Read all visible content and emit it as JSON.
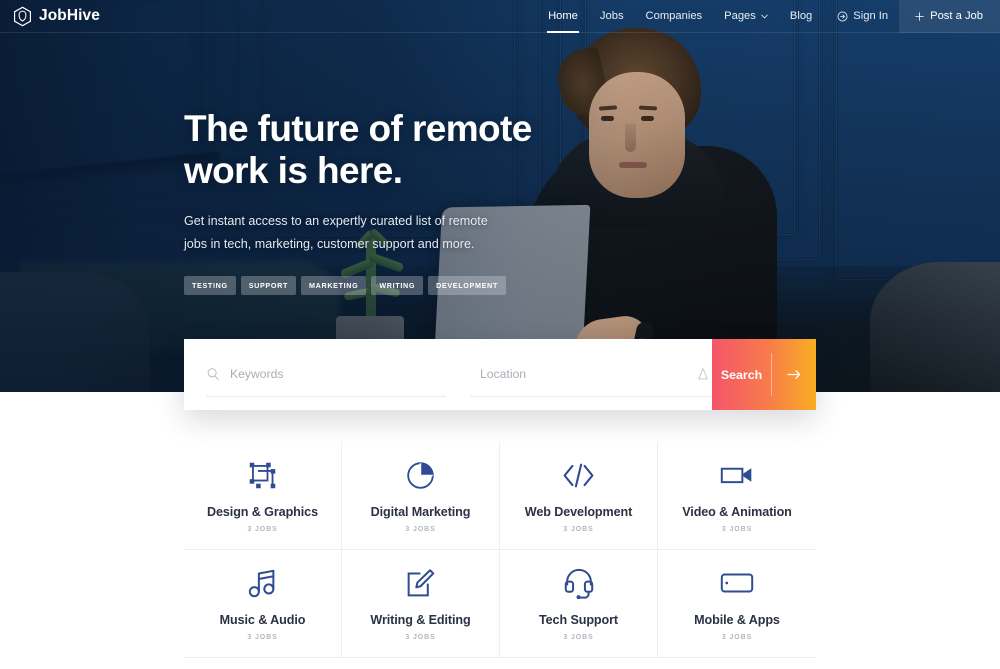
{
  "brand": {
    "name": "JobHive",
    "logo_icon": "hexagon-hive-logo"
  },
  "nav": {
    "items": [
      {
        "label": "Home",
        "active": true
      },
      {
        "label": "Jobs",
        "active": false
      },
      {
        "label": "Companies",
        "active": false
      },
      {
        "label": "Pages",
        "active": false,
        "icon": "chevron-down-icon"
      },
      {
        "label": "Blog",
        "active": false
      }
    ],
    "sign_in": {
      "label": "Sign In",
      "icon": "sign-in-arrow-circle-icon"
    },
    "post_a_job": {
      "label": "Post a Job",
      "icon": "plus-icon"
    }
  },
  "hero": {
    "title_line1": "The future of remote",
    "title_line2": "work is here.",
    "subtitle_line1": "Get instant access to an expertly curated list of remote jobs in",
    "subtitle_line2": "tech, marketing, customer support and more.",
    "tags": [
      "Testing",
      "Support",
      "Marketing",
      "Writing",
      "Development"
    ]
  },
  "search": {
    "keywords": {
      "placeholder": "Keywords",
      "value": "",
      "icon": "search-icon"
    },
    "location": {
      "placeholder": "Location",
      "value": "",
      "icon": "location-pin-icon"
    },
    "button": {
      "label": "Search",
      "arrow_icon": "arrow-right-icon"
    }
  },
  "categories": {
    "items": [
      {
        "name": "Design & Graphics",
        "jobs": "3 Jobs",
        "icon": "crop-frame-icon"
      },
      {
        "name": "Digital Marketing",
        "jobs": "3 Jobs",
        "icon": "pie-chart-icon"
      },
      {
        "name": "Web Development",
        "jobs": "3 Jobs",
        "icon": "code-brackets-icon"
      },
      {
        "name": "Video & Animation",
        "jobs": "3 Jobs",
        "icon": "video-camera-icon"
      },
      {
        "name": "Music & Audio",
        "jobs": "3 Jobs",
        "icon": "music-note-icon"
      },
      {
        "name": "Writing & Editing",
        "jobs": "3 Jobs",
        "icon": "edit-pencil-square-icon"
      },
      {
        "name": "Tech Support",
        "jobs": "3 Jobs",
        "icon": "headset-icon"
      },
      {
        "name": "Mobile & Apps",
        "jobs": "3 Jobs",
        "icon": "tablet-device-icon"
      }
    ]
  },
  "colors": {
    "hero_navy": "#12355e",
    "accent_start": "#f4556a",
    "accent_end": "#f9ae22",
    "icon_blue": "#2f4b92",
    "heading_dark": "#2b3245"
  }
}
